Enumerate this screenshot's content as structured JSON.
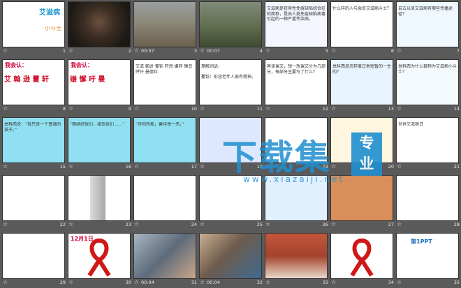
{
  "slides": [
    {
      "num": "1",
      "timing": "",
      "kind": "cover",
      "title": "艾滋病",
      "text": "小斗士",
      "bg": "#ffffff"
    },
    {
      "num": "2",
      "timing": "",
      "kind": "photo-face",
      "title": "",
      "text": "",
      "bg": "#2b2620"
    },
    {
      "num": "3",
      "timing": "00:07",
      "kind": "photo-child",
      "title": "",
      "text": "",
      "bg": "#8e8a7a"
    },
    {
      "num": "4",
      "timing": "00:07",
      "kind": "photo-grave",
      "title": "",
      "text": "",
      "bg": "#6f7d5e"
    },
    {
      "num": "5",
      "timing": "",
      "kind": "text",
      "title": "",
      "text": "艾滋病是获得性免疫缺陷综合征的简称，是由人类免疫缺陷病毒引起的一种严重传染病。",
      "bg": "#f3f6ff"
    },
    {
      "num": "6",
      "timing": "",
      "kind": "text",
      "title": "",
      "text": "什么样的人与会是艾滋病斗士？",
      "bg": "#ffffff"
    },
    {
      "num": "7",
      "timing": "",
      "kind": "text",
      "title": "",
      "text": "自古以来艾滋病有哪些传播途径？",
      "bg": "#f0f8ff"
    },
    {
      "num": "8",
      "timing": "",
      "kind": "words",
      "title": "我会认：",
      "text": "艾 翰 逊 矍 轩",
      "bg": "#ffffff"
    },
    {
      "num": "9",
      "timing": "",
      "kind": "words",
      "title": "我会认：",
      "text": "嫌 懈 吁 曼",
      "bg": "#ffffff"
    },
    {
      "num": "10",
      "timing": "",
      "kind": "text",
      "title": "",
      "text": "艾滋 翰逊 矍铄 轩然 嫌弃 懈怠 呼吁 曼德拉",
      "bg": "#ffffff"
    },
    {
      "num": "11",
      "timing": "",
      "kind": "text",
      "title": "",
      "text": "理解词语：\n\n矍铄：形容老年人很有精神。",
      "bg": "#ffffff"
    },
    {
      "num": "12",
      "timing": "",
      "kind": "text",
      "title": "",
      "text": "再读课文，想一想课文分为几部分，每部分主要写了什么？",
      "bg": "#ffffff"
    },
    {
      "num": "13",
      "timing": "",
      "kind": "text",
      "title": "",
      "text": "恩科西是怎样度过他短暂的一生的？",
      "bg": "#e8f4ff"
    },
    {
      "num": "14",
      "timing": "",
      "kind": "text",
      "title": "",
      "text": "恩科西为什么被称为艾滋病小斗士？",
      "bg": "#f5faff"
    },
    {
      "num": "15",
      "timing": "",
      "kind": "text",
      "title": "",
      "text": "恩科西说：“我只是一个普通的孩子。”",
      "bg": "#8fe0f0"
    },
    {
      "num": "16",
      "timing": "",
      "kind": "text",
      "title": "",
      "text": "“照顾好我们，接受我们……”",
      "bg": "#8fe0f0"
    },
    {
      "num": "17",
      "timing": "",
      "kind": "text",
      "title": "",
      "text": "“尽你所能，善待每一天。”",
      "bg": "#8fe0f0"
    },
    {
      "num": "18",
      "timing": "",
      "kind": "text",
      "title": "",
      "text": "",
      "bg": "#dde8ff"
    },
    {
      "num": "19",
      "timing": "",
      "kind": "text",
      "title": "",
      "text": "",
      "bg": "#ffffff"
    },
    {
      "num": "20",
      "timing": "",
      "kind": "text",
      "title": "",
      "text": "",
      "bg": "#fff6e0"
    },
    {
      "num": "21",
      "timing": "",
      "kind": "text",
      "title": "",
      "text": "世界艾滋病日",
      "bg": "#ffffff"
    },
    {
      "num": "22",
      "timing": "",
      "kind": "text",
      "title": "",
      "text": "",
      "bg": "#ffffff"
    },
    {
      "num": "23",
      "timing": "",
      "kind": "photo-person",
      "title": "",
      "text": "",
      "bg": "#ffffff"
    },
    {
      "num": "24",
      "timing": "",
      "kind": "text",
      "title": "",
      "text": "",
      "bg": "#ffffff"
    },
    {
      "num": "25",
      "timing": "",
      "kind": "text",
      "title": "",
      "text": "",
      "bg": "#ffffff"
    },
    {
      "num": "26",
      "timing": "",
      "kind": "text",
      "title": "",
      "text": "",
      "bg": "#e0f0ff"
    },
    {
      "num": "27",
      "timing": "",
      "kind": "text",
      "title": "",
      "text": "",
      "bg": "#d88f5a"
    },
    {
      "num": "28",
      "timing": "",
      "kind": "text",
      "title": "",
      "text": "",
      "bg": "#ffffff"
    },
    {
      "num": "29",
      "timing": "",
      "kind": "text",
      "title": "",
      "text": "",
      "bg": "#ffffff"
    },
    {
      "num": "30",
      "timing": "",
      "kind": "ribbon",
      "title": "12月1日",
      "text": "",
      "bg": "#ffffff"
    },
    {
      "num": "31",
      "timing": "00:04",
      "kind": "photo-group",
      "title": "",
      "text": "",
      "bg": "#7f8ea0"
    },
    {
      "num": "32",
      "timing": "00:04",
      "kind": "photo-group2",
      "title": "",
      "text": "",
      "bg": "#8a7768"
    },
    {
      "num": "33",
      "timing": "",
      "kind": "photo-crowd",
      "title": "",
      "text": "",
      "bg": "#a4432e"
    },
    {
      "num": "34",
      "timing": "",
      "kind": "ribbon2",
      "title": "",
      "text": "",
      "bg": "#ffffff"
    },
    {
      "num": "35",
      "timing": "",
      "kind": "ppt",
      "title": "第1PPT",
      "text": "",
      "bg": "#ffffff"
    }
  ],
  "watermark": {
    "main": "下载集",
    "box_top": "专",
    "box_bottom": "业",
    "url": "www.xiazaiji.net"
  }
}
